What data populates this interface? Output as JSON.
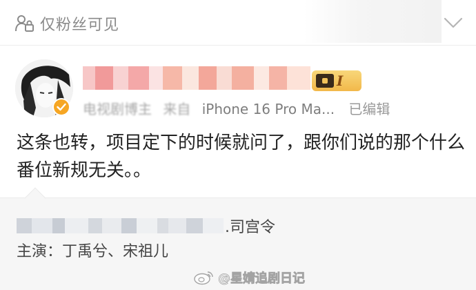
{
  "topbar": {
    "visibility_label": "仅粉丝可见",
    "lock_icon": "lock-person-icon",
    "expand_icon": "chevron-down-icon"
  },
  "post": {
    "author_category": "电视剧博主",
    "source_prefix": "来自",
    "device": "iPhone 16 Pro Ma...",
    "edited": "已编辑",
    "member_level": "I",
    "verified_icon": "verified-check-icon",
    "body": "这条也转，项目定下的时候就问了，跟你们说的那个什么番位新规无关。。"
  },
  "quoted": {
    "title_suffix": ".司宫令",
    "cast_line": "主演：丁禹兮、宋祖儿"
  },
  "watermark": {
    "text": "@星婧追剧日记",
    "icon": "weibo-logo-icon"
  },
  "colors": {
    "accent_gold": "#f2b84a",
    "muted_text": "#9a9a9a",
    "quote_bg": "#f6f6f6"
  }
}
